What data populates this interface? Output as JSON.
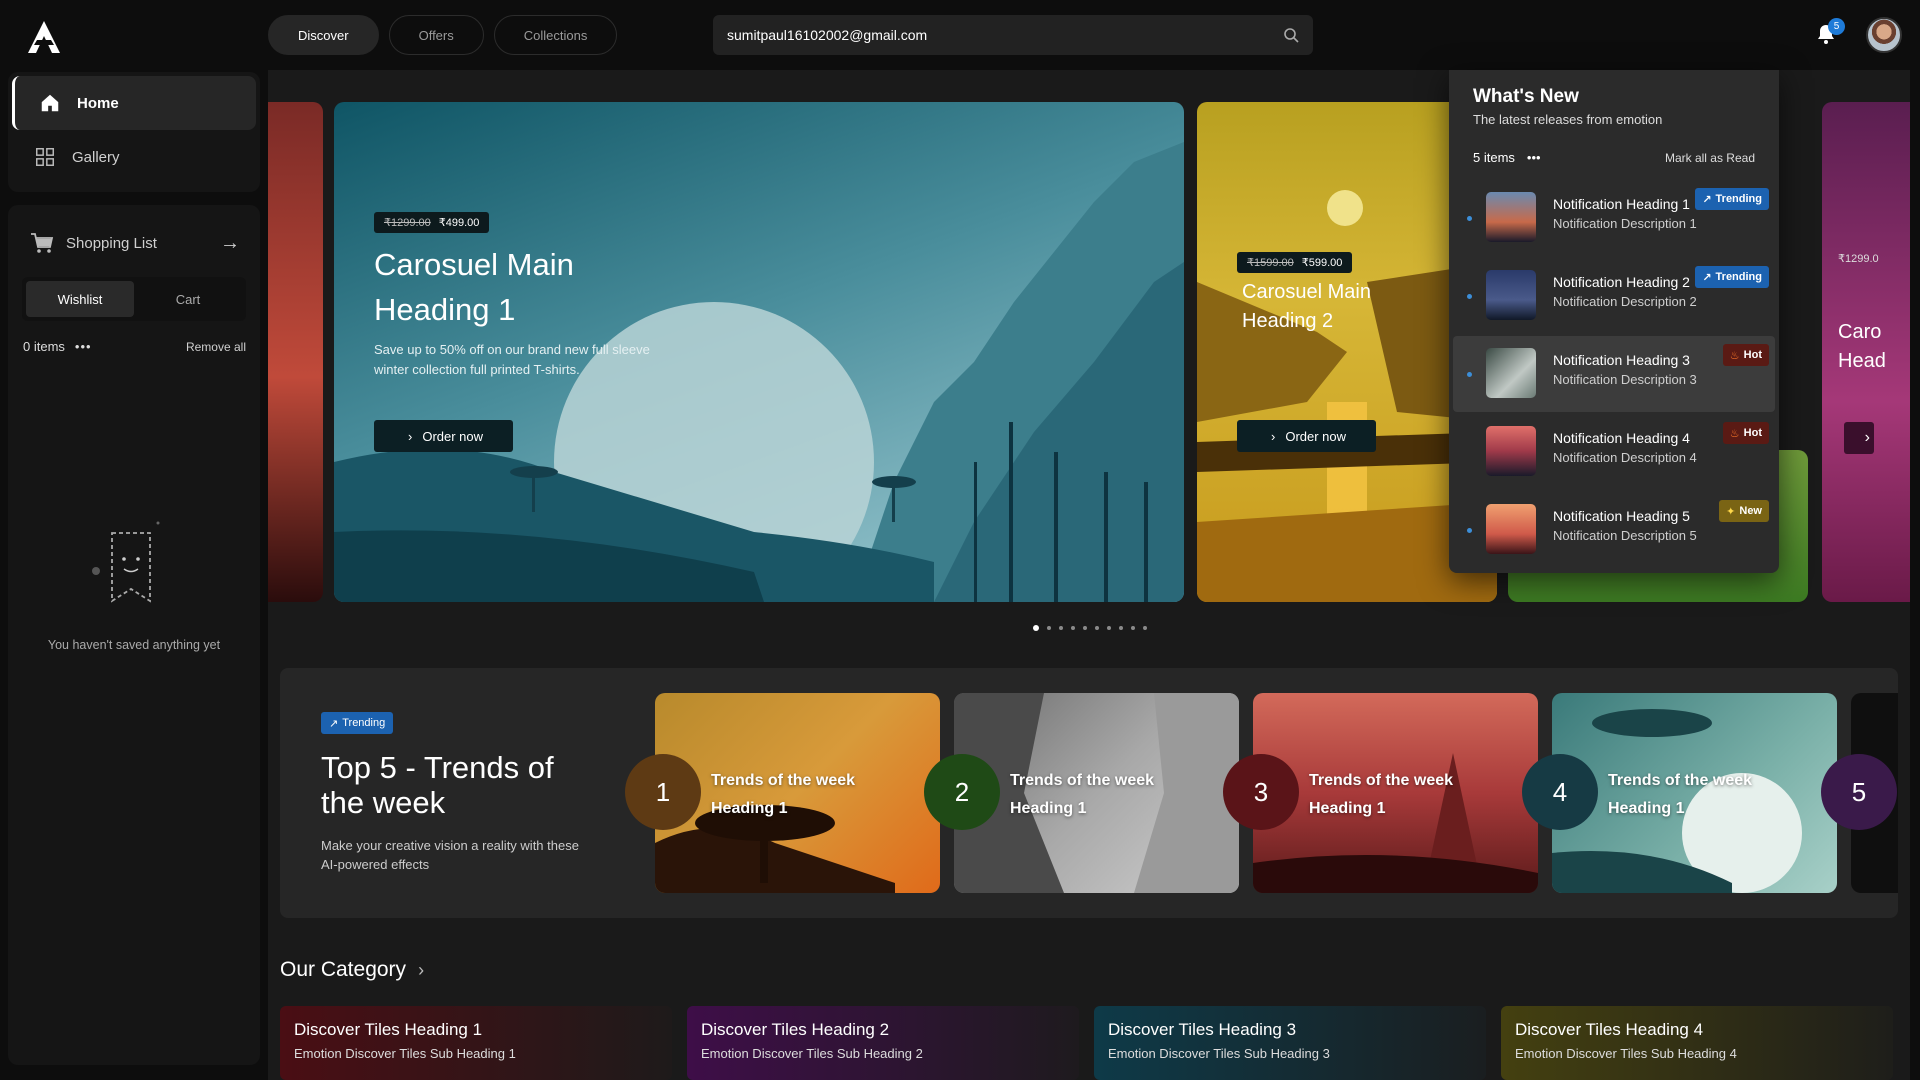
{
  "nav": {
    "tabs": [
      "Discover",
      "Offers",
      "Collections"
    ],
    "active_tab": 0
  },
  "search": {
    "value": "sumitpaul16102002@gmail.com"
  },
  "notifications_badge": "5",
  "sidebar": {
    "items": [
      {
        "label": "Home",
        "icon": "home-icon"
      },
      {
        "label": "Gallery",
        "icon": "grid-icon"
      }
    ]
  },
  "shopping": {
    "title": "Shopping List",
    "tabs": [
      "Wishlist",
      "Cart"
    ],
    "count": "0 items",
    "remove": "Remove all",
    "empty": "You haven't saved anything yet"
  },
  "carousel": {
    "main": {
      "old_price": "₹1299.00",
      "price": "₹499.00",
      "heading_line1": "Carosuel Main",
      "heading_line2": "Heading 1",
      "desc_line1": "Save up to 50% off on our brand new full sleeve",
      "desc_line2": "winter collection full printed T-shirts.",
      "cta": "Order now"
    },
    "second": {
      "old_price": "₹1599.00",
      "price": "₹599.00",
      "heading_line1": "Carosuel Main",
      "heading_line2": "Heading 2",
      "cta": "Order now"
    },
    "fourth": {
      "old_price": "₹1299.0",
      "heading_line1": "Caro",
      "heading_line2": "Head"
    }
  },
  "whats_new": {
    "title": "What's New",
    "subtitle": "The latest releases from emotion",
    "count": "5 items",
    "mark_all": "Mark all as Read",
    "items": [
      {
        "heading": "Notification Heading 1",
        "desc": "Notification Description 1",
        "badge": "Trending"
      },
      {
        "heading": "Notification Heading 2",
        "desc": "Notification Description 2",
        "badge": "Trending"
      },
      {
        "heading": "Notification Heading 3",
        "desc": "Notification Description 3",
        "badge": "Hot"
      },
      {
        "heading": "Notification Heading 4",
        "desc": "Notification Description 4",
        "badge": "Hot"
      },
      {
        "heading": "Notification Heading 5",
        "desc": "Notification Description 5",
        "badge": "New"
      }
    ]
  },
  "trends": {
    "badge": "Trending",
    "title": "Top 5 - Trends of the week",
    "desc": "Make your creative vision a reality with these AI-powered effects",
    "cards": [
      {
        "num": "1",
        "line1": "Trends of the week",
        "line2": "Heading 1"
      },
      {
        "num": "2",
        "line1": "Trends of the week",
        "line2": "Heading 1"
      },
      {
        "num": "3",
        "line1": "Trends of the week",
        "line2": "Heading 1"
      },
      {
        "num": "4",
        "line1": "Trends of the week",
        "line2": "Heading 1"
      },
      {
        "num": "5"
      }
    ]
  },
  "category": {
    "title": "Our Category",
    "tiles": [
      {
        "heading": "Discover Tiles Heading 1",
        "sub": "Emotion Discover Tiles Sub Heading 1"
      },
      {
        "heading": "Discover Tiles Heading 2",
        "sub": "Emotion Discover Tiles Sub Heading 2"
      },
      {
        "heading": "Discover Tiles Heading 3",
        "sub": "Emotion Discover Tiles Sub Heading 3"
      },
      {
        "heading": "Discover Tiles Heading 4",
        "sub": "Emotion Discover Tiles Sub Heading 4"
      }
    ]
  },
  "colors": {
    "accent": "#1c62b0",
    "bg": "#0d0d0d",
    "panel": "#151515"
  }
}
